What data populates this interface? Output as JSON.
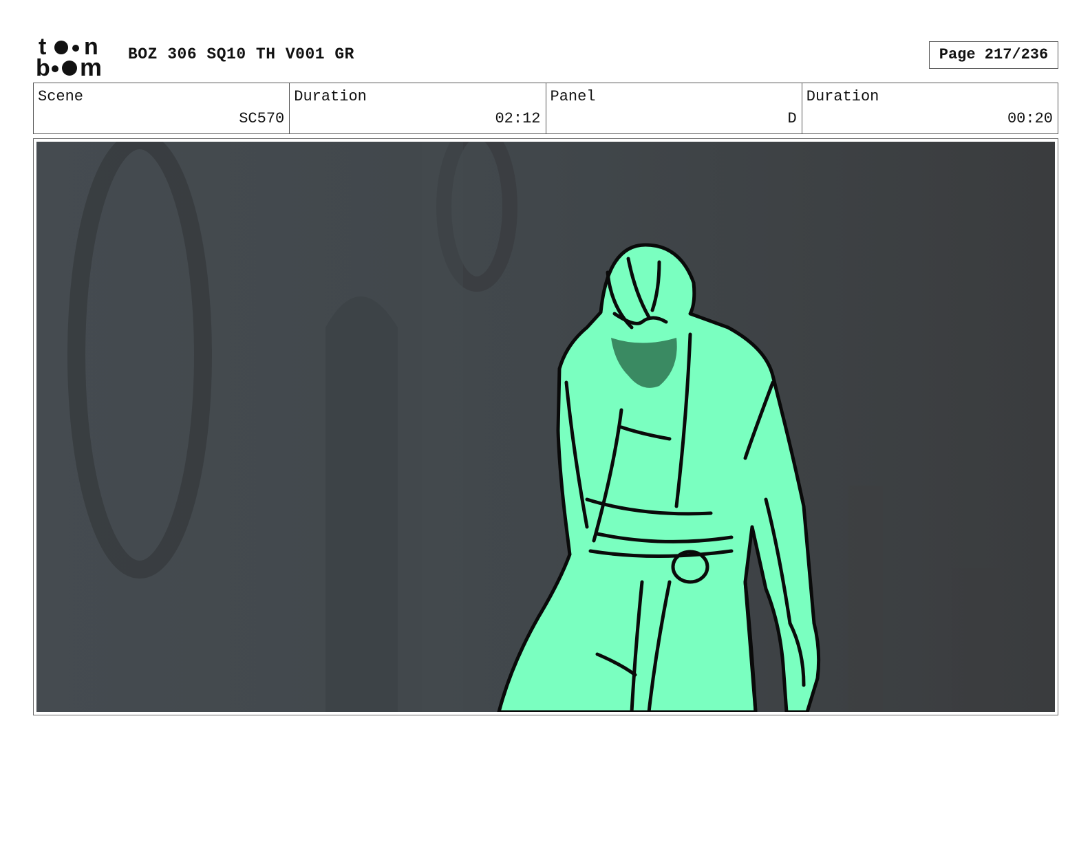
{
  "header": {
    "logo_alt": "toon boom",
    "title": "BOZ 306 SQ10 TH V001 GR",
    "page": "Page 217/236"
  },
  "info": {
    "scene_label": "Scene",
    "scene_value": "SC570",
    "scene_duration_label": "Duration",
    "scene_duration_value": "02:12",
    "panel_label": "Panel",
    "panel_value": "D",
    "panel_duration_label": "Duration",
    "panel_duration_value": "00:20"
  },
  "panel": {
    "description": "",
    "figure_fill": "#7affc0",
    "background_color": "#3e4448",
    "line_color": "#0a0a0a"
  }
}
